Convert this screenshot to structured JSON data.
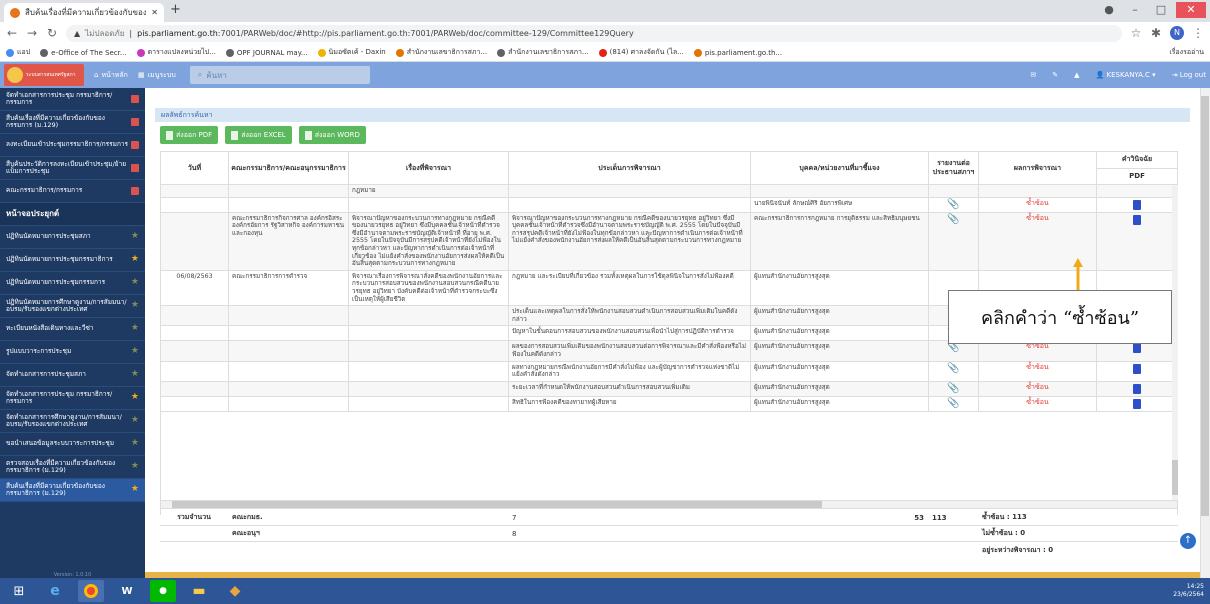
{
  "browser": {
    "tab_title": "สืบค้นเรื่องที่มีความเกี่ยวข้องกับของคณะ",
    "new_tab": "+",
    "url_security": "ไม่ปลอดภัย",
    "url_host": "pis.parliament.go.th",
    "url_path": ":7001/PARWeb/doc/#http://pis.parliament.go.th:7001/PARWeb/doc/committee-129/Committee129Query",
    "profile_initial": "N",
    "bookmarks": [
      {
        "label": "แอป",
        "color": "#4a8af4"
      },
      {
        "label": "e-Office of The Secr...",
        "color": "#5f6368"
      },
      {
        "label": "ตารางแปลงหน่วยไป...",
        "color": "#c83ab8"
      },
      {
        "label": "OPF JOURNAL may...",
        "color": "#5f6368"
      },
      {
        "label": "นิมอซัตเค้ - Daxin",
        "color": "#f0b400"
      },
      {
        "label": "สำนักงานเลขาธิการสภา...",
        "color": "#e37400"
      },
      {
        "label": "สำนักงานเลขาธิการสภา...",
        "color": "#5f6368"
      },
      {
        "label": "(814) ศาลงจัดกัน (ไล...",
        "color": "#e62117"
      },
      {
        "label": "pis.parliament.go.th...",
        "color": "#e37400"
      }
    ],
    "reading_list": "เรื่องรออ่าน"
  },
  "app": {
    "logo_text": "ระบบสารสนเทศรัฐสภา",
    "home": "หน้าหลัก",
    "menu": "เมนูระบบ",
    "search_placeholder": "ค้นหา",
    "user": "KESKANYA.C",
    "logout": "Log out"
  },
  "sidebar": [
    {
      "label": "จัดทำเอกสารการประชุม กรรมาธิการ/กรรมการ",
      "mark": "sq"
    },
    {
      "label": "สืบค้นเรื่องที่มีความเกี่ยวข้องกับของกรรมการ (ม.129)",
      "mark": "sq"
    },
    {
      "label": "ลงทะเบียนเข้าประชุมกรรมาธิการ/กรรมการ",
      "mark": "sq"
    },
    {
      "label": "สืบค้นประวัติการลงทะเบียนเข้าประชุม/ย้ายแบ็มการประชุม",
      "mark": "sq"
    },
    {
      "label": "คณะกรรมาธิการ/กรรมการ",
      "mark": "sq"
    },
    {
      "label": "หน้าจอประยุกต์",
      "mark": "hd"
    },
    {
      "label": "ปฏิทินนัดหมายการประชุมสภา",
      "mark": "st-dim"
    },
    {
      "label": "ปฏิทินนัดหมายการประชุมกรรมาธิการ",
      "mark": "st"
    },
    {
      "label": "ปฏิทินนัดหมายการประชุมกรรมการ",
      "mark": "st-dim"
    },
    {
      "label": "ปฏิทินนัดหมายการศึกษาดูงาน/การสัมมนา/อบรม/รับรองแขกต่างประเทศ",
      "mark": "st-dim"
    },
    {
      "label": "ทะเบียนหนังสือเดินทางและวีซ่า",
      "mark": "st-dim"
    },
    {
      "label": "รูปแบบวาระการประชุม",
      "mark": "st-dim"
    },
    {
      "label": "จัดทำเอกสารการประชุมสภา",
      "mark": "st-dim"
    },
    {
      "label": "จัดทำเอกสารการประชุม กรรมาธิการ/กรรมการ",
      "mark": "st"
    },
    {
      "label": "จัดทำเอกสารการศึกษาดูงาน/การสัมมนา/อบรม/รับรองแขกต่างประเทศ",
      "mark": "st-dim"
    },
    {
      "label": "ขอนำเสนอข้อมูลระบบวาระการประชุม",
      "mark": "st-dim"
    },
    {
      "label": "ตรวจสอบเรื่องที่มีความเกี่ยวข้องกับของกรรมาธิการ (ม.129)",
      "mark": "st-dim"
    },
    {
      "label": "สืบค้นเรื่องที่มีความเกี่ยวข้องกับของกรรมาธิการ (ม.129)",
      "mark": "st"
    }
  ],
  "sidebar_version": "Version: 1.0.10",
  "results": {
    "title": "ผลลัพธ์การค้นหา",
    "export_pdf": "ส่งออก PDF",
    "export_excel": "ส่งออก EXCEL",
    "export_word": "ส่งออก WORD",
    "columns": {
      "date": "วันที่",
      "committee": "คณะกรรมาธิการ/คณะอนุกรรมาธิการ",
      "subject": "เรื่องที่พิจารณา",
      "issue": "ประเด็นการพิจารณา",
      "person": "บุคคล/หน่วยงานที่มาชี้แจง",
      "report": "รายงานต่อประธานสภาฯ",
      "result": "ผลการพิจารณา",
      "order": "คำวินิจฉัย",
      "pdf": "PDF"
    },
    "rows": [
      {
        "date": "",
        "committee": "",
        "subject": "กฎหมาย",
        "issue": "",
        "person": "",
        "clip": false,
        "result": "",
        "pdf": false
      },
      {
        "date": "",
        "committee": "",
        "subject": "",
        "issue": "",
        "person": "นายพินิจนันท์ ลักษณ์ศิริ อัยการพิเศษ",
        "clip": true,
        "result": "ซ้ำซ้อน",
        "pdf": true
      },
      {
        "date": "",
        "committee": "คณะกรรมาธิการกิจการศาล องค์กรอิสระ องค์กรอัยการ รัฐวิสาหกิจ องค์การมหาชน และกองทุน",
        "subject": "พิจารณาปัญหาของกระบวนการทางกฎหมาย กรณีคดีของนายวรยุทธ อยู่วิทยา ซึ่งมีบุคคลชั้นเจ้าหน้าที่ตำรวจซึ่งมีอำนาจตามพระราชบัญญัติเจ้าหน้าที่ ที่อายุ พ.ศ. 2555 โดยในปัจจุบันมีการสรุปคดีเจ้าหน้าที่ยังไม่ฟ้องในทุกข้อกล่าวหา และปัญหาการดำเนินการต่อเจ้าหน้าที่เกี่ยวข้อง ไม่แย้งคำสั่งของพนักงานอัยการส่งผลให้คดีเป็นอันสิ้นสุดตามกระบวนการทางกฎหมาย",
        "issue": "พิจารณาปัญหาของกระบวนการทางกฎหมาย กรณีคดีของนายวรยุทธ อยู่วิทยา ซึ่งมีบุคคลชั้นเจ้าหน้าที่ตำรวจซึ่งมีอำนาจตามพระราชบัญญัติ พ.ศ. 2555 โดยในปัจจุบันมีการสรุปคดีเจ้าหน้าที่ยังไม่ฟ้องในทุกข้อกล่าวหา และปัญหาการดำเนินการต่อเจ้าหน้าที่ ไม่แย้งคำสั่งของพนักงานอัยการส่งผลให้คดีเป็นอันสิ้นสุดตามกระบวนการทางกฎหมาย",
        "person": "คณะกรรมาธิการการกฎหมาย การยุติธรรม และสิทธิมนุษยชน",
        "clip": true,
        "result": "ซ้ำซ้อน",
        "pdf": true
      },
      {
        "date": "06/08/2563",
        "committee": "คณะกรรมาธิการการตำรวจ",
        "subject": "พิจารณาเรื่องการพิจารณาสั่งคดีของพนักงานอัยการและกระบวนการสอบสวนของพนักงานสอบสวนกรณีคดีนายวรยุทธ อยู่วิทยา บังคับคดีต่อเจ้าหน้าที่ตำรวจกระบะซึ่งเป็นเหตุให้ผู้เสียชีวิต",
        "issue": "กฎหมาย และระเบียบที่เกี่ยวข้อง รวมทั้งเหตุผลในการใช้ดุลพินิจในการสั่งไม่ฟ้องคดี",
        "person": "ผู้แทนสำนักงานอัยการสูงสุด",
        "clip": false,
        "result": "",
        "pdf": false
      },
      {
        "date": "",
        "committee": "",
        "subject": "",
        "issue": "ประเด็นและเหตุผลในการสั่งให้พนักงานสอบสวนดำเนินการสอบสวนเพิ่มเติมในคดีดังกล่าว",
        "person": "ผู้แทนสำนักงานอัยการสูงสุด",
        "clip": true,
        "result": "ซ้ำซ้อน",
        "pdf": true
      },
      {
        "date": "",
        "committee": "",
        "subject": "",
        "issue": "ปัญหาในขั้นตอนการสอบสวนของพนักงานสอบสวนเพื่อนำไปสู่การปฏิบัติการตำรวจ",
        "person": "ผู้แทนสำนักงานอัยการสูงสุด",
        "clip": true,
        "result": "ซ้ำซ้อน",
        "pdf": true
      },
      {
        "date": "",
        "committee": "",
        "subject": "",
        "issue": "ผลของการสอบสวนเพิ่มเติมของพนักงานสอบสวนต่อการพิจารณาและมีคำสั่งฟ้องหรือไม่ฟ้องในคดีดังกล่าว",
        "person": "ผู้แทนสำนักงานอัยการสูงสุด",
        "clip": true,
        "result": "ซ้ำซ้อน",
        "pdf": true
      },
      {
        "date": "",
        "committee": "",
        "subject": "",
        "issue": "ผลทางกฎหมายกรณีพนักงานอัยการมีคำสั่งไม่ฟ้อง และผู้บัญชาการตำรวจแห่งชาติไม่แย้งคำสั่งดังกล่าว",
        "person": "ผู้แทนสำนักงานอัยการสูงสุด",
        "clip": true,
        "result": "ซ้ำซ้อน",
        "pdf": true
      },
      {
        "date": "",
        "committee": "",
        "subject": "",
        "issue": "ระยะเวลาที่กำหนดให้พนักงานสอบสวนดำเนินการสอบสวนเพิ่มเติม",
        "person": "ผู้แทนสำนักงานอัยการสูงสุด",
        "clip": true,
        "result": "ซ้ำซ้อน",
        "pdf": true
      },
      {
        "date": "",
        "committee": "",
        "subject": "",
        "issue": "สิทธิในการฟ้องคดีของทายาทผู้เสียหาย",
        "person": "ผู้แทนสำนักงานอัยการสูงสุด",
        "clip": true,
        "result": "ซ้ำซ้อน",
        "pdf": true
      }
    ],
    "summary": {
      "label": "รวมจำนวน",
      "row1_name": "คณะกมธ.",
      "row1_count": "7",
      "row2_name": "คณะอนุฯ",
      "row2_count": "8",
      "issues_count": "53",
      "persons_count": "113",
      "dup": "ซ้ำซ้อน : 113",
      "notdup": "ไม่ซ้ำซ้อน : 0",
      "pending": "อยู่ระหว่างพิจารณา : 0"
    }
  },
  "callout": "คลิกคำว่า “ซ้ำซ้อน”",
  "taskbar": {
    "time": "14:25",
    "date": "23/6/2564"
  },
  "colors": {
    "header": "#7fa3dc",
    "sidebar": "#1e3a63",
    "export": "#5cb85c",
    "dup": "#e3413b",
    "arrow": "#f2a818"
  }
}
